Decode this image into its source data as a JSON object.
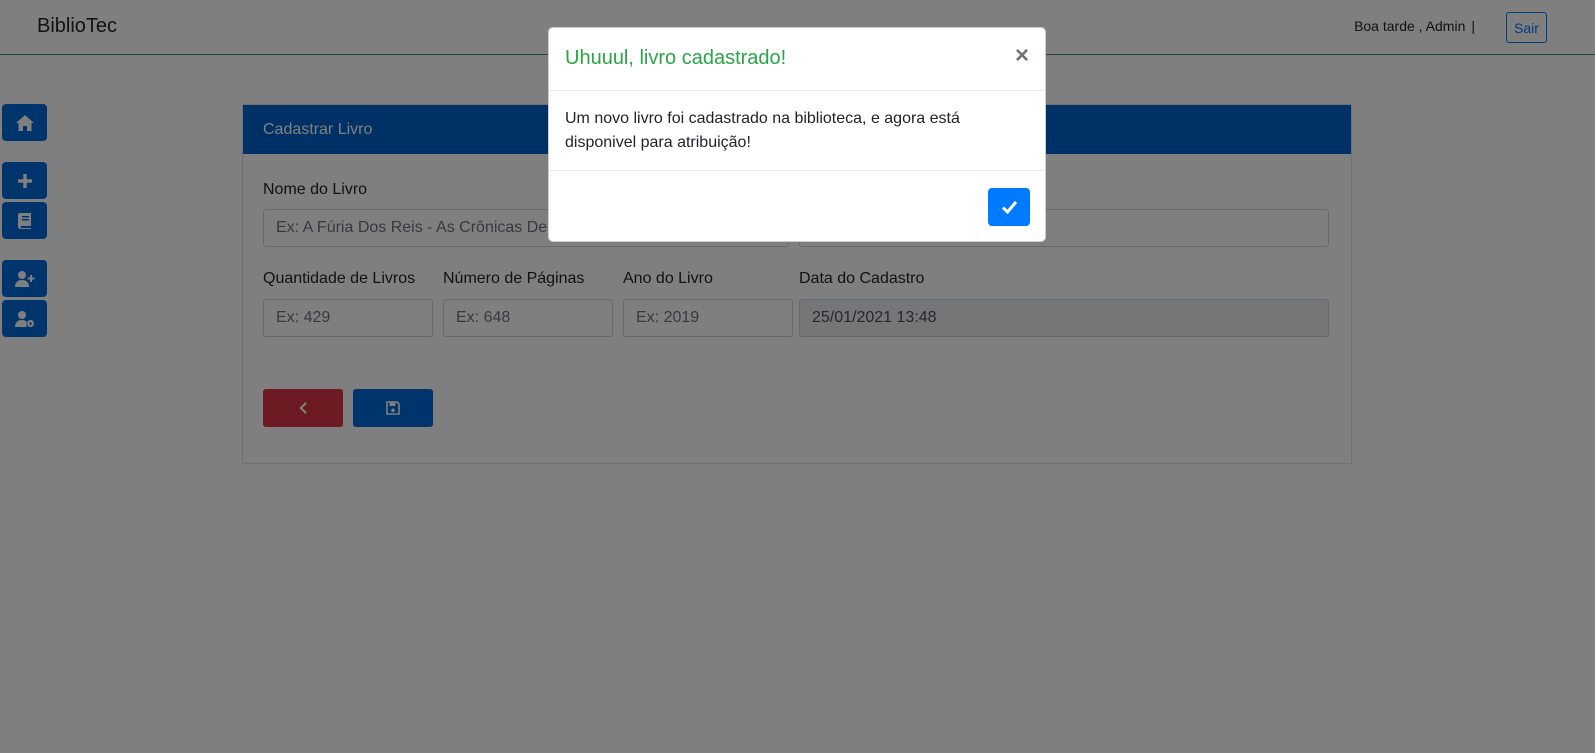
{
  "navbar": {
    "brand": "BiblioTec",
    "greeting": "Boa tarde , Admin",
    "separator": "|",
    "logout_label": "Sair"
  },
  "sidebar": {
    "items": [
      {
        "icon": "home-icon"
      },
      {
        "icon": "plus-icon"
      },
      {
        "icon": "book-icon"
      },
      {
        "icon": "user-plus-icon"
      },
      {
        "icon": "user-cog-icon"
      }
    ]
  },
  "form": {
    "header": "Cadastrar Livro",
    "book_name_label": "Nome do Livro",
    "book_name_placeholder": "Ex: A Fúria Dos Reis - As Crônicas De G",
    "quantity_label": "Quantidade de Livros",
    "quantity_placeholder": "Ex: 429",
    "pages_label": "Número de Páginas",
    "pages_placeholder": "Ex: 648",
    "year_label": "Ano do Livro",
    "year_placeholder": "Ex: 2019",
    "date_label": "Data do Cadastro",
    "date_value": "25/01/2021 13:48"
  },
  "modal": {
    "title": "Uhuuul, livro cadastrado!",
    "close_symbol": "×",
    "body": "Um novo livro foi cadastrado na biblioteca, e agora está disponivel para atribuição!"
  },
  "colors": {
    "primary": "#007bff",
    "success": "#28a745",
    "danger": "#dc3545"
  }
}
